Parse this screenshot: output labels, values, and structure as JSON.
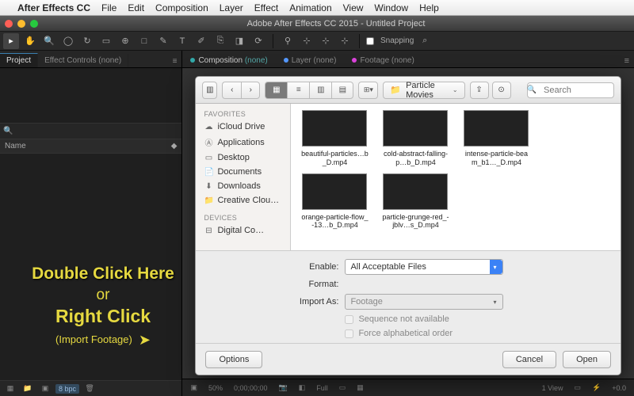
{
  "mac_menu": {
    "app_name": "After Effects CC",
    "items": [
      "File",
      "Edit",
      "Composition",
      "Layer",
      "Effect",
      "Animation",
      "View",
      "Window",
      "Help"
    ]
  },
  "window_title": "Adobe After Effects CC 2015 - Untitled Project",
  "toolbar": {
    "snapping_label": "Snapping"
  },
  "project_panel": {
    "tab_project": "Project",
    "tab_effect_controls": "Effect Controls (none)",
    "col_name": "Name",
    "bpc_label": "8 bpc",
    "search_placeholder": ""
  },
  "annotation": {
    "line1": "Double Click Here",
    "line2": "or",
    "line3": "Right Click",
    "line4": "(Import Footage)"
  },
  "comp_panel": {
    "tab_composition": "Composition",
    "tab_composition_status": "(none)",
    "tab_layer": "Layer (none)",
    "tab_footage": "Footage (none)"
  },
  "dialog": {
    "path_label": "Particle Movies",
    "search_placeholder": "Search",
    "sidebar": {
      "favorites_head": "Favorites",
      "favorites": [
        "iCloud Drive",
        "Applications",
        "Desktop",
        "Documents",
        "Downloads",
        "Creative Clou…"
      ],
      "devices_head": "Devices",
      "devices": [
        "Digital Co…"
      ]
    },
    "files": [
      {
        "name": "beautiful-particles…b_D.mp4",
        "thumb": "th1"
      },
      {
        "name": "cold-abstract-falling-p…b_D.mp4",
        "thumb": "th2"
      },
      {
        "name": "intense-particle-beam_b1…_D.mp4",
        "thumb": "th3"
      },
      {
        "name": "orange-particle-flow_-13…b_D.mp4",
        "thumb": "th4"
      },
      {
        "name": "particle-grunge-red_-jblv…s_D.mp4",
        "thumb": "th5"
      }
    ],
    "options": {
      "enable_label": "Enable:",
      "enable_value": "All Acceptable Files",
      "format_label": "Format:",
      "format_value": "",
      "import_as_label": "Import As:",
      "import_as_value": "Footage",
      "sequence_label": "Sequence not available",
      "alpha_label": "Force alphabetical order"
    },
    "buttons": {
      "options": "Options",
      "cancel": "Cancel",
      "open": "Open"
    }
  },
  "comp_footer": {
    "zoom": "50%",
    "res": "Full",
    "view": "1 View",
    "exposure": "+0.0",
    "timecode": "0;00;00;00"
  }
}
